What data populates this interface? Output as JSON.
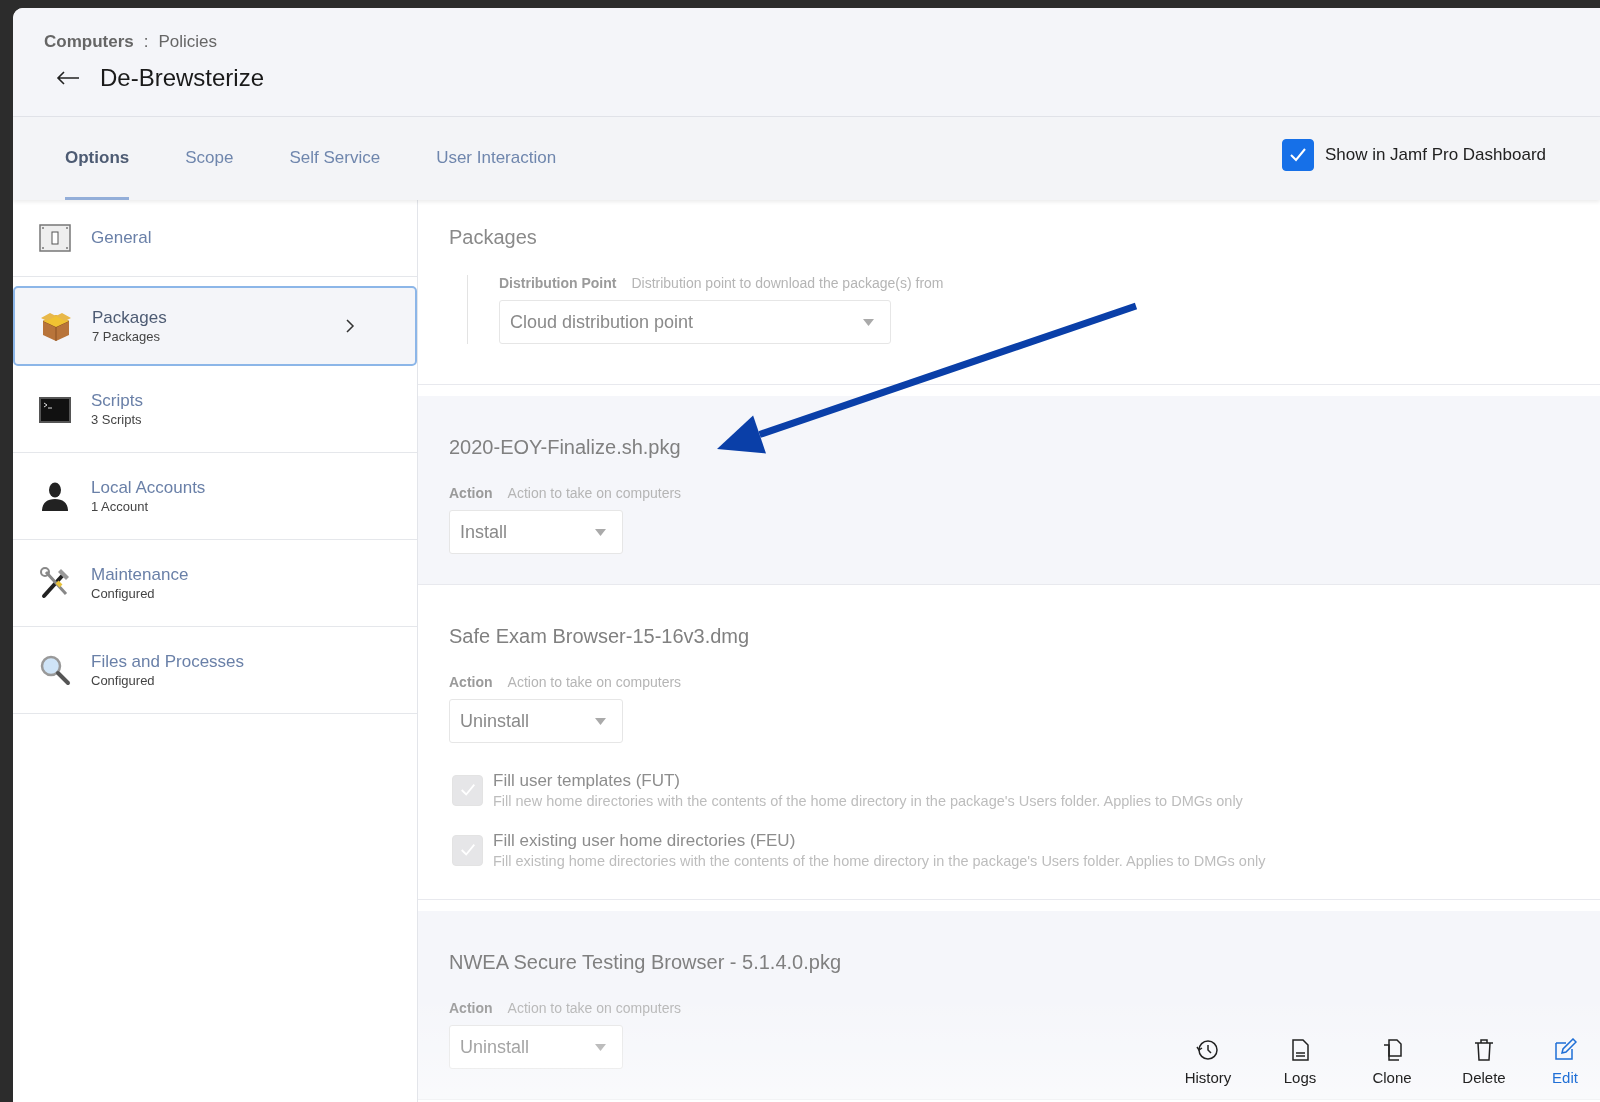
{
  "breadcrumb": {
    "parent": "Computers",
    "separator": ":",
    "current": "Policies"
  },
  "title": "De-Brewsterize",
  "tabs": [
    {
      "label": "Options",
      "selected": true
    },
    {
      "label": "Scope",
      "selected": false
    },
    {
      "label": "Self Service",
      "selected": false
    },
    {
      "label": "User Interaction",
      "selected": false
    }
  ],
  "dashboard_checkbox": {
    "label": "Show in Jamf Pro Dashboard",
    "checked": true
  },
  "sidebar": {
    "items": [
      {
        "kind": "switch",
        "title": "General",
        "selected": false
      },
      {
        "kind": "box",
        "title": "Packages",
        "subtitle": "7 Packages",
        "selected": true
      },
      {
        "kind": "terminal",
        "title": "Scripts",
        "subtitle": "3 Scripts",
        "selected": false
      },
      {
        "kind": "person",
        "title": "Local Accounts",
        "subtitle": "1 Account",
        "selected": false
      },
      {
        "kind": "tools",
        "title": "Maintenance",
        "subtitle": "Configured",
        "selected": false
      },
      {
        "kind": "magnifier",
        "title": "Files and Processes",
        "subtitle": "Configured",
        "selected": false
      }
    ]
  },
  "section_title": "Packages",
  "distribution_point": {
    "label": "Distribution Point",
    "hint": "Distribution point to download the package(s) from",
    "value": "Cloud distribution point"
  },
  "packages": [
    {
      "name": "2020-EOY-Finalize.sh.pkg",
      "action_label": "Action",
      "action_hint": "Action to take on computers",
      "action": "Install"
    },
    {
      "name": "Safe Exam Browser-15-16v3.dmg",
      "action_label": "Action",
      "action_hint": "Action to take on computers",
      "action": "Uninstall",
      "options": [
        {
          "label": "Fill user templates (FUT)",
          "description": "Fill new home directories with the contents of the home directory in the package's Users folder. Applies to DMGs only",
          "checked": true,
          "disabled": true
        },
        {
          "label": "Fill existing user home directories (FEU)",
          "description": "Fill existing home directories with the contents of the home directory in the package's Users folder. Applies to DMGs only",
          "checked": true,
          "disabled": true
        }
      ]
    },
    {
      "name": "NWEA Secure Testing Browser - 5.1.4.0.pkg",
      "action_label": "Action",
      "action_hint": "Action to take on computers",
      "action": "Uninstall"
    }
  ],
  "toolbar": [
    {
      "kind": "history",
      "label": "History",
      "primary": false
    },
    {
      "kind": "logs",
      "label": "Logs",
      "primary": false
    },
    {
      "kind": "clone",
      "label": "Clone",
      "primary": false
    },
    {
      "kind": "delete",
      "label": "Delete",
      "primary": false
    },
    {
      "kind": "edit",
      "label": "Edit",
      "primary": true
    }
  ]
}
